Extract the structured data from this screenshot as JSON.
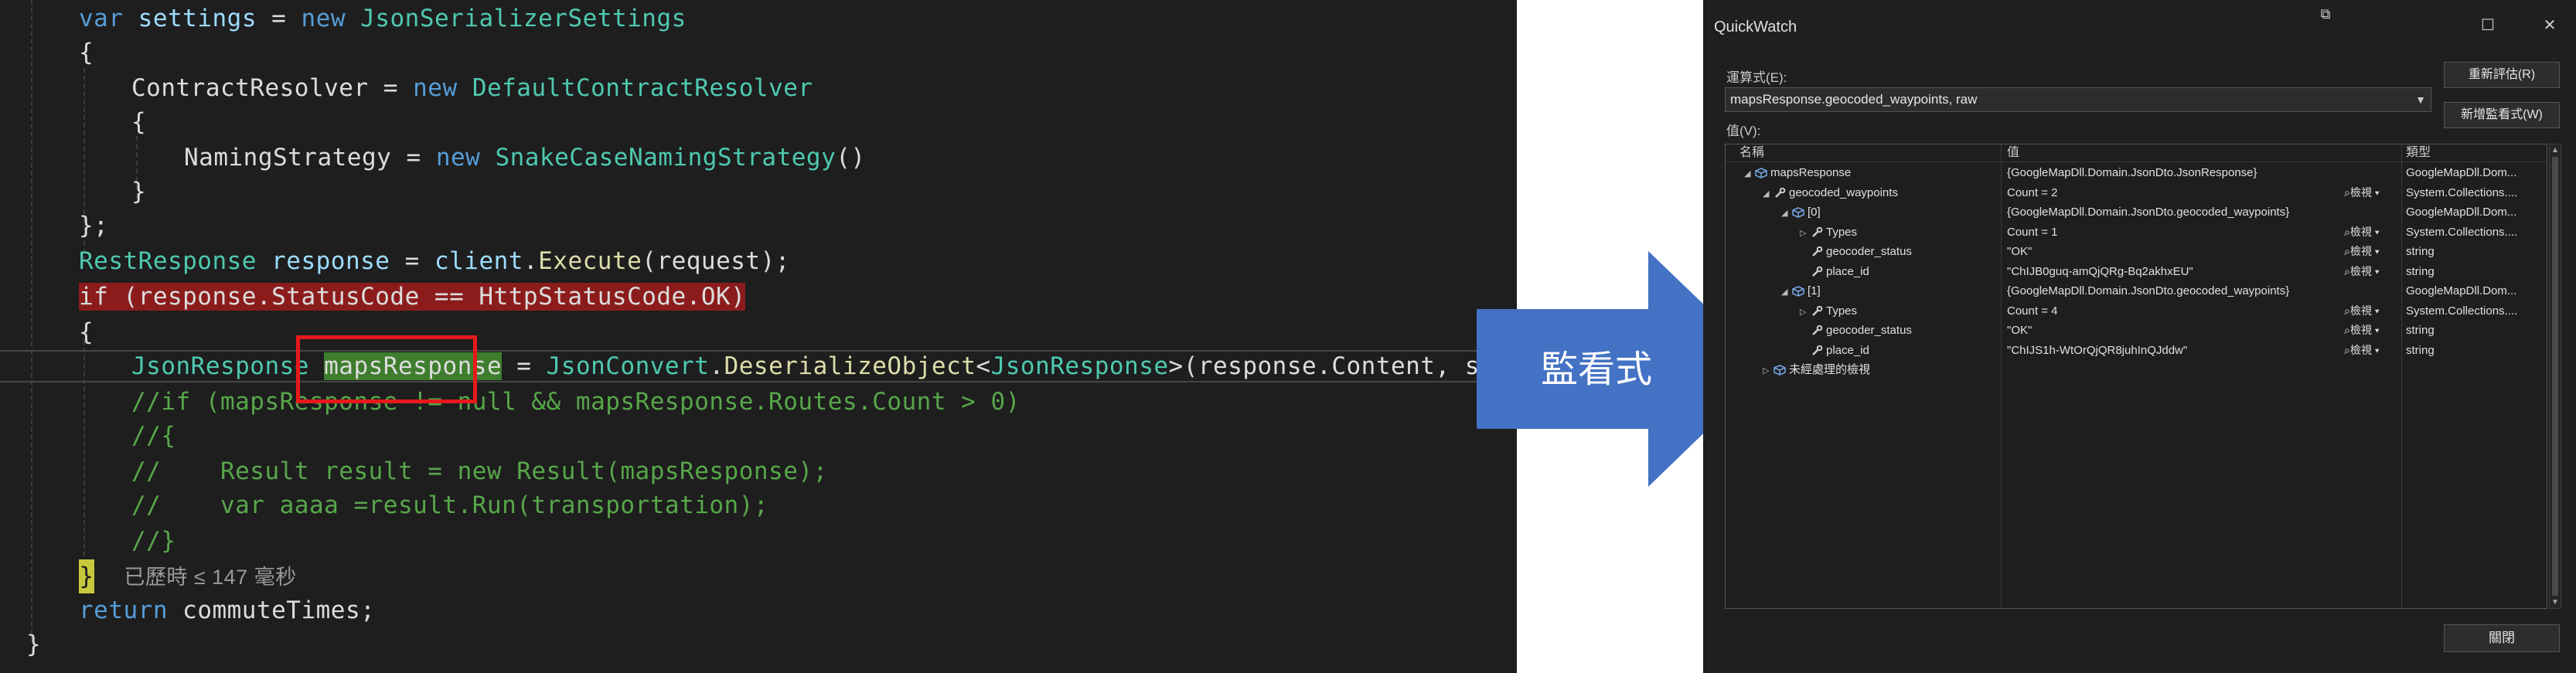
{
  "editor": {
    "line1": {
      "var": "var",
      "name": "settings",
      "eq": "=",
      "new": "new",
      "type": "JsonSerializerSettings"
    },
    "line2": "{",
    "line3": {
      "name": "ContractResolver",
      "eq": "=",
      "new": "new",
      "type": "DefaultContractResolver"
    },
    "line4": "{",
    "line5": {
      "name": "NamingStrategy",
      "eq": "=",
      "new": "new",
      "type": "SnakeCaseNamingStrategy",
      "tail": "()"
    },
    "line6": "}",
    "line7": "};",
    "line8": {
      "type": "RestResponse",
      "name": "response",
      "eq": "=",
      "obj": "client",
      "dot": ".",
      "method": "Execute",
      "tail": "(request);"
    },
    "line9": "if (response.StatusCode == HttpStatusCode.OK)",
    "line10": "{",
    "line11": {
      "type": "JsonResponse",
      "highlighted": "mapsResponse",
      "eq": "=",
      "cls": "JsonConvert",
      "dot": ".",
      "method": "DeserializeObject",
      "lt": "<",
      "gtype": "JsonResponse",
      "tail": ">(response.Content, settings);"
    },
    "line12": "//if (mapsResponse != null && mapsResponse.Routes.Count > 0)",
    "line13": "//{",
    "line14": "//    Result result = new Result(mapsResponse);",
    "line15": "//    var aaaa =result.Run(transportation);",
    "line16": "//}",
    "line17": {
      "brace": "}",
      "elapsed": "已歷時 ≤ 147 毫秒"
    },
    "line18": {
      "kw": "return",
      "tail": "commuteTimes;"
    },
    "line19": "}"
  },
  "arrow": {
    "label": "監看式",
    "color": "#4472c4"
  },
  "quickwatch": {
    "title": "QuickWatch",
    "window_buttons": {
      "pin": "⧉",
      "maximize": "☐",
      "close": "✕"
    },
    "expression_label": "運算式(E):",
    "expression_value": "mapsResponse.geocoded_waypoints, raw",
    "value_label": "值(V):",
    "reevaluate_button": "重新評估(R)",
    "add_watch_button": "新增監看式(W)",
    "close_button": "關閉",
    "columns": {
      "name": "名稱",
      "value": "值",
      "type": "類型"
    },
    "view_label": "檢視",
    "rows": [
      {
        "name": "mapsResponse",
        "value": "{GoogleMapDll.Domain.JsonDto.JsonResponse}",
        "type": "GoogleMapDll.Dom...",
        "toggle": "◢",
        "icon": "object-icon",
        "view": ""
      },
      {
        "name": "geocoded_waypoints",
        "value": "Count = 2",
        "type": "System.Collections....",
        "toggle": "◢",
        "icon": "wrench-icon",
        "view": "檢視"
      },
      {
        "name": "[0]",
        "value": "{GoogleMapDll.Domain.JsonDto.geocoded_waypoints}",
        "type": "GoogleMapDll.Dom...",
        "toggle": "◢",
        "icon": "object-icon",
        "view": ""
      },
      {
        "name": "Types",
        "value": "Count = 1",
        "type": "System.Collections....",
        "toggle": "▷",
        "icon": "wrench-icon",
        "view": "檢視"
      },
      {
        "name": "geocoder_status",
        "value": "\"OK\"",
        "type": "string",
        "toggle": "",
        "icon": "wrench-icon",
        "view": "檢視"
      },
      {
        "name": "place_id",
        "value": "\"ChIJB0guq-amQjQRg-Bq2akhxEU\"",
        "type": "string",
        "toggle": "",
        "icon": "wrench-icon",
        "view": "檢視"
      },
      {
        "name": "[1]",
        "value": "{GoogleMapDll.Domain.JsonDto.geocoded_waypoints}",
        "type": "GoogleMapDll.Dom...",
        "toggle": "◢",
        "icon": "object-icon",
        "view": ""
      },
      {
        "name": "Types",
        "value": "Count = 4",
        "type": "System.Collections....",
        "toggle": "▷",
        "icon": "wrench-icon",
        "view": "檢視"
      },
      {
        "name": "geocoder_status",
        "value": "\"OK\"",
        "type": "string",
        "toggle": "",
        "icon": "wrench-icon",
        "view": "檢視"
      },
      {
        "name": "place_id",
        "value": "\"ChIJS1h-WtOrQjQR8juhInQJddw\"",
        "type": "string",
        "toggle": "",
        "icon": "wrench-icon",
        "view": "檢視"
      },
      {
        "name": "未經處理的檢視",
        "value": "",
        "type": "",
        "toggle": "▷",
        "icon": "object-icon",
        "view": ""
      }
    ]
  }
}
